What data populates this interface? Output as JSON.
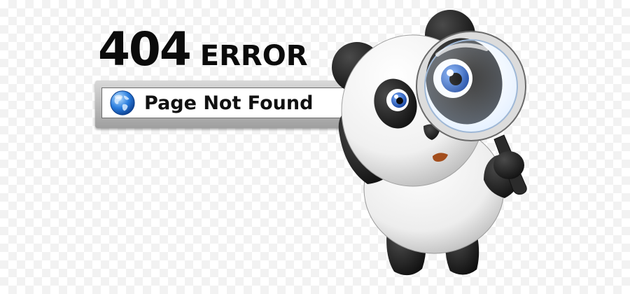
{
  "error": {
    "code": "404",
    "word": "ERROR",
    "message": "Page Not Found"
  },
  "icons": {
    "address_bar": "globe-icon",
    "mascot": "panda-mascot",
    "magnifier": "magnifying-glass-icon"
  },
  "colors": {
    "heading": "#0b0b0b",
    "globe_blue": "#1f6fd1",
    "panda_black": "#141414",
    "eye_blue": "#1c55b8"
  }
}
